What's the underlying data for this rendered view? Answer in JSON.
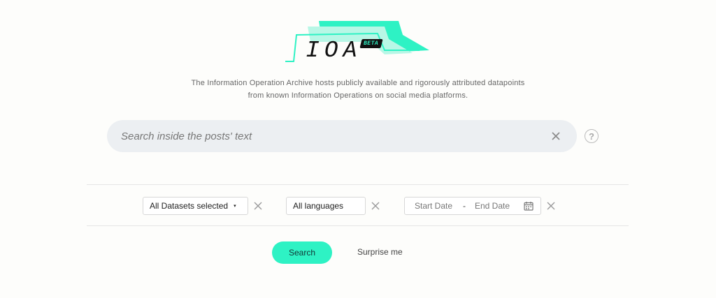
{
  "brand": {
    "logo_text": "IOA",
    "badge": "BETA",
    "accent_color": "#2ef2c4"
  },
  "tagline": {
    "line1": "The Information Operation Archive hosts publicly available and rigorously attributed datapoints",
    "line2": "from known Information Operations on social media platforms."
  },
  "search": {
    "placeholder": "Search inside the posts' text",
    "value": "",
    "clear_icon": "close-icon",
    "help_label": "?"
  },
  "filters": {
    "datasets": {
      "label": "All Datasets selected",
      "caret": "▾"
    },
    "languages": {
      "label": "All languages"
    },
    "dates": {
      "start": "Start Date",
      "separator": "-",
      "end": "End Date",
      "icon": "calendar-icon"
    }
  },
  "actions": {
    "search_label": "Search",
    "surprise_label": "Surprise me"
  }
}
